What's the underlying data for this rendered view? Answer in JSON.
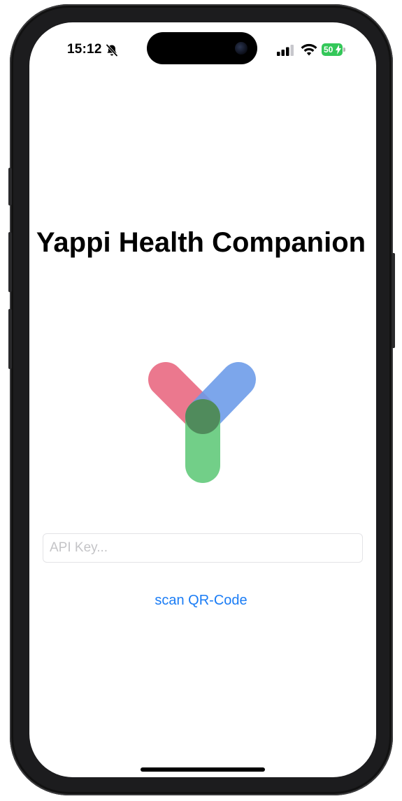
{
  "status_bar": {
    "time": "15:12",
    "silent_icon": "bell-slash-icon",
    "signal_icon": "cellular-signal-icon",
    "wifi_icon": "wifi-icon",
    "battery_level": "50",
    "battery_charging": true,
    "battery_color": "#34c759"
  },
  "app": {
    "title": "Yappi Health Companion",
    "logo_icon": "yappi-y-logo",
    "logo_colors": {
      "left_arm": "#e8657e",
      "right_arm": "#6a9ae8",
      "stem": "#5ec878"
    }
  },
  "form": {
    "api_key_value": "",
    "api_key_placeholder": "API Key...",
    "scan_label": "scan QR-Code",
    "link_color": "#1a7cf5"
  }
}
